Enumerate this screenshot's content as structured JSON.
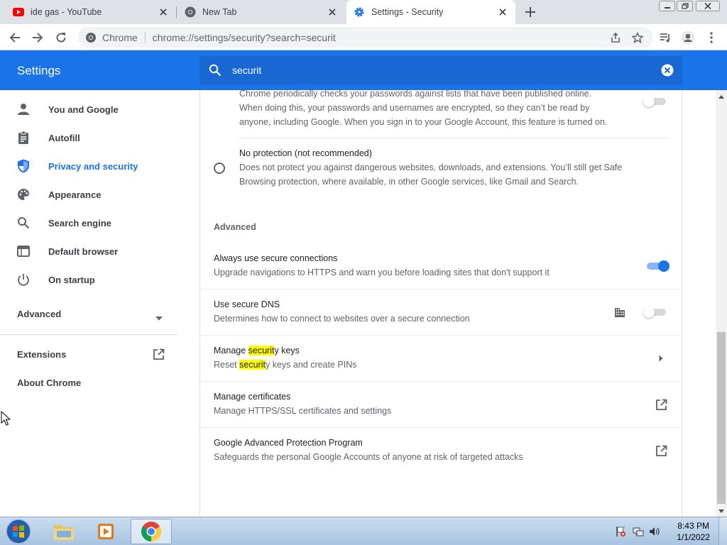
{
  "browser": {
    "tabs": [
      {
        "title": "ide gas - YouTube",
        "icon": "youtube-icon"
      },
      {
        "title": "New Tab",
        "icon": "chrome-icon"
      },
      {
        "title": "Settings - Security",
        "icon": "gear-icon"
      }
    ],
    "omnibox": {
      "site": "Chrome",
      "url": "chrome://settings/security?search=securit"
    }
  },
  "header": {
    "title": "Settings",
    "search_query": "securit"
  },
  "sidebar": {
    "items": [
      {
        "label": "You and Google",
        "icon": "person-icon"
      },
      {
        "label": "Autofill",
        "icon": "clipboard-icon"
      },
      {
        "label": "Privacy and security",
        "icon": "shield-icon"
      },
      {
        "label": "Appearance",
        "icon": "palette-icon"
      },
      {
        "label": "Search engine",
        "icon": "search-icon"
      },
      {
        "label": "Default browser",
        "icon": "browser-window-icon"
      },
      {
        "label": "On startup",
        "icon": "power-icon"
      }
    ],
    "advanced": "Advanced",
    "extensions": "Extensions",
    "about": "About Chrome"
  },
  "main": {
    "password_check": {
      "line1": "Chrome periodically checks your passwords against lists that have been published online.",
      "line2": "When doing this, your passwords and usernames are encrypted, so they can’t be read by",
      "line3": "anyone, including Google. When you sign in to your Google Account, this feature is turned on.",
      "enabled": false
    },
    "no_protection": {
      "title": "No protection (not recommended)",
      "line1": "Does not protect you against dangerous websites, downloads, and extensions. You’ll still get Safe",
      "line2": "Browsing protection, where available, in other Google services, like Gmail and Search."
    },
    "advanced_heading": "Advanced",
    "rows": {
      "secure_connections": {
        "title": "Always use secure connections",
        "desc": "Upgrade navigations to HTTPS and warn you before loading sites that don't support it",
        "enabled": true
      },
      "secure_dns": {
        "title": "Use secure DNS",
        "desc": "Determines how to connect to websites over a secure connection",
        "enabled": false
      },
      "security_keys": {
        "title_pre": "Manage ",
        "title_hl": "securit",
        "title_post": "y keys",
        "desc_pre": "Reset ",
        "desc_hl": "securit",
        "desc_post": "y keys and create PINs"
      },
      "certificates": {
        "title": "Manage certificates",
        "desc": "Manage HTTPS/SSL certificates and settings"
      },
      "advanced_protection": {
        "title": "Google Advanced Protection Program",
        "desc": "Safeguards the personal Google Accounts of anyone at risk of targeted attacks"
      }
    }
  },
  "taskbar": {
    "time": "8:43 PM",
    "date": "1/1/2022"
  },
  "colors": {
    "accent": "#1a73e8",
    "highlight": "#ffff00"
  }
}
